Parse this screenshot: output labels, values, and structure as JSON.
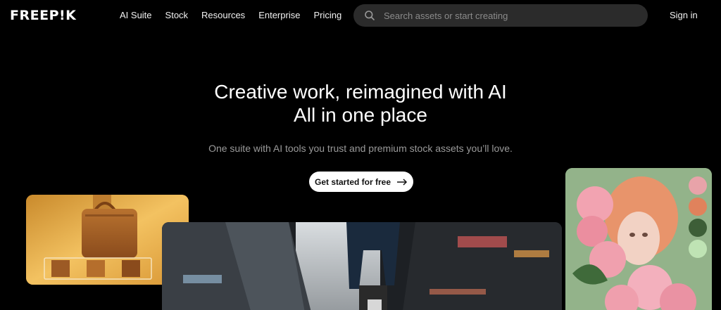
{
  "header": {
    "logo": "FREEP!K",
    "nav": [
      "AI Suite",
      "Stock",
      "Resources",
      "Enterprise",
      "Pricing"
    ],
    "search": {
      "placeholder": "Search assets or start creating",
      "value": ""
    },
    "signin": "Sign in"
  },
  "hero": {
    "title_line1": "Creative work, reimagined with AI",
    "title_line2": "All in one place",
    "subtitle": "One suite with AI tools you trust and premium stock assets you’ll love.",
    "cta": "Get started for free"
  },
  "gallery": {
    "bag_card": {
      "subject": "leather handbag",
      "thumbnails": 3
    },
    "bike_card": {
      "subject": "cyclist in city street"
    },
    "portrait_card": {
      "subject": "portrait with pink flowers",
      "palette": [
        "#e8a3a9",
        "#e0825c",
        "#3d5e37",
        "#bfe3b4"
      ]
    }
  },
  "colors": {
    "background": "#000000",
    "search_bg": "#2b2b2b",
    "cta_bg": "#ffffff",
    "subtitle": "#9a9a9a"
  }
}
